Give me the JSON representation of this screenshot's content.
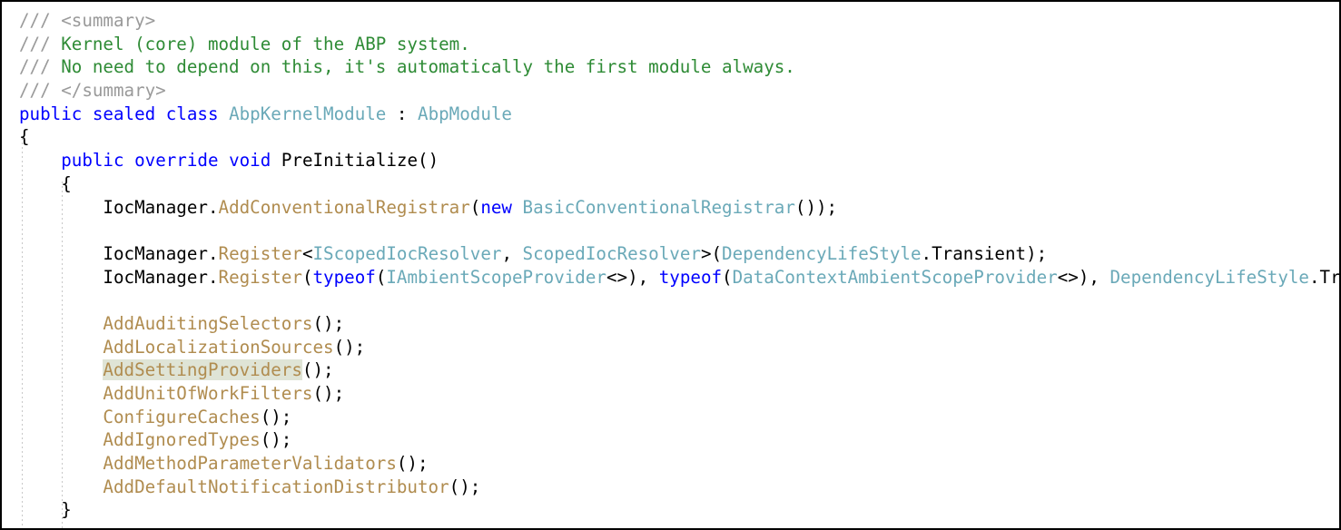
{
  "editor": {
    "language": "csharp",
    "theme": "light",
    "colors": {
      "background": "#ffffff",
      "plain": "#000000",
      "keyword": "#0000ff",
      "type": "#6aa9b8",
      "method": "#b08c4f",
      "comment": "#2e8b35",
      "comment_marker": "#9a9a9a",
      "xml_doc_tag": "#9a9a9a",
      "reference_highlight": "#dfe4d6",
      "indent_guide": "#c8c8c8",
      "frame_border": "#000000"
    },
    "highlighted_symbol": "AddSettingProviders",
    "truncated_right_edge": true
  },
  "code": {
    "lines": [
      {
        "n": 1,
        "indent": 0,
        "tokens": [
          {
            "text": "/// ",
            "kind": "commentmark"
          },
          {
            "text": "<summary>",
            "kind": "xmltag"
          }
        ]
      },
      {
        "n": 2,
        "indent": 0,
        "tokens": [
          {
            "text": "/// ",
            "kind": "commentmark"
          },
          {
            "text": "Kernel (core) module of the ABP system.",
            "kind": "comment"
          }
        ]
      },
      {
        "n": 3,
        "indent": 0,
        "tokens": [
          {
            "text": "/// ",
            "kind": "commentmark"
          },
          {
            "text": "No need to depend on this, it's automatically the first module always.",
            "kind": "comment"
          }
        ]
      },
      {
        "n": 4,
        "indent": 0,
        "tokens": [
          {
            "text": "/// ",
            "kind": "commentmark"
          },
          {
            "text": "</summary>",
            "kind": "xmltag"
          }
        ]
      },
      {
        "n": 5,
        "indent": 0,
        "tokens": [
          {
            "text": "public",
            "kind": "keyword"
          },
          {
            "text": " ",
            "kind": "plain"
          },
          {
            "text": "sealed",
            "kind": "keyword"
          },
          {
            "text": " ",
            "kind": "plain"
          },
          {
            "text": "class",
            "kind": "keyword"
          },
          {
            "text": " ",
            "kind": "plain"
          },
          {
            "text": "AbpKernelModule",
            "kind": "type"
          },
          {
            "text": " : ",
            "kind": "plain"
          },
          {
            "text": "AbpModule",
            "kind": "type"
          }
        ]
      },
      {
        "n": 6,
        "indent": 0,
        "tokens": [
          {
            "text": "{",
            "kind": "punct"
          }
        ]
      },
      {
        "n": 7,
        "indent": 1,
        "tokens": [
          {
            "text": "    ",
            "kind": "plain"
          },
          {
            "text": "public",
            "kind": "keyword"
          },
          {
            "text": " ",
            "kind": "plain"
          },
          {
            "text": "override",
            "kind": "keyword"
          },
          {
            "text": " ",
            "kind": "plain"
          },
          {
            "text": "void",
            "kind": "keyword"
          },
          {
            "text": " ",
            "kind": "plain"
          },
          {
            "text": "PreInitialize",
            "kind": "plain"
          },
          {
            "text": "()",
            "kind": "punct"
          }
        ]
      },
      {
        "n": 8,
        "indent": 1,
        "tokens": [
          {
            "text": "    {",
            "kind": "punct"
          }
        ]
      },
      {
        "n": 9,
        "indent": 2,
        "tokens": [
          {
            "text": "        ",
            "kind": "plain"
          },
          {
            "text": "IocManager",
            "kind": "plain"
          },
          {
            "text": ".",
            "kind": "punct"
          },
          {
            "text": "AddConventionalRegistrar",
            "kind": "method"
          },
          {
            "text": "(",
            "kind": "punct"
          },
          {
            "text": "new",
            "kind": "keyword"
          },
          {
            "text": " ",
            "kind": "plain"
          },
          {
            "text": "BasicConventionalRegistrar",
            "kind": "type"
          },
          {
            "text": "());",
            "kind": "punct"
          }
        ]
      },
      {
        "n": 10,
        "indent": 2,
        "tokens": []
      },
      {
        "n": 11,
        "indent": 2,
        "tokens": [
          {
            "text": "        ",
            "kind": "plain"
          },
          {
            "text": "IocManager",
            "kind": "plain"
          },
          {
            "text": ".",
            "kind": "punct"
          },
          {
            "text": "Register",
            "kind": "method"
          },
          {
            "text": "<",
            "kind": "punct"
          },
          {
            "text": "IScopedIocResolver",
            "kind": "type"
          },
          {
            "text": ", ",
            "kind": "punct"
          },
          {
            "text": "ScopedIocResolver",
            "kind": "type"
          },
          {
            "text": ">(",
            "kind": "punct"
          },
          {
            "text": "DependencyLifeStyle",
            "kind": "type"
          },
          {
            "text": ".",
            "kind": "punct"
          },
          {
            "text": "Transient",
            "kind": "plain"
          },
          {
            "text": ");",
            "kind": "punct"
          }
        ]
      },
      {
        "n": 12,
        "indent": 2,
        "truncated": true,
        "tokens": [
          {
            "text": "        ",
            "kind": "plain"
          },
          {
            "text": "IocManager",
            "kind": "plain"
          },
          {
            "text": ".",
            "kind": "punct"
          },
          {
            "text": "Register",
            "kind": "method"
          },
          {
            "text": "(",
            "kind": "punct"
          },
          {
            "text": "typeof",
            "kind": "keyword"
          },
          {
            "text": "(",
            "kind": "punct"
          },
          {
            "text": "IAmbientScopeProvider",
            "kind": "type"
          },
          {
            "text": "<>), ",
            "kind": "punct"
          },
          {
            "text": "typeof",
            "kind": "keyword"
          },
          {
            "text": "(",
            "kind": "punct"
          },
          {
            "text": "DataContextAmbientScopeProvider",
            "kind": "type"
          },
          {
            "text": "<>), ",
            "kind": "punct"
          },
          {
            "text": "DependencyLifeStyle",
            "kind": "type"
          },
          {
            "text": ".",
            "kind": "punct"
          },
          {
            "text": "Trans",
            "kind": "plain"
          }
        ]
      },
      {
        "n": 13,
        "indent": 2,
        "tokens": []
      },
      {
        "n": 14,
        "indent": 2,
        "tokens": [
          {
            "text": "        ",
            "kind": "plain"
          },
          {
            "text": "AddAuditingSelectors",
            "kind": "method"
          },
          {
            "text": "();",
            "kind": "punct"
          }
        ]
      },
      {
        "n": 15,
        "indent": 2,
        "tokens": [
          {
            "text": "        ",
            "kind": "plain"
          },
          {
            "text": "AddLocalizationSources",
            "kind": "method"
          },
          {
            "text": "();",
            "kind": "punct"
          }
        ]
      },
      {
        "n": 16,
        "indent": 2,
        "tokens": [
          {
            "text": "        ",
            "kind": "plain"
          },
          {
            "text": "AddSettingProviders",
            "kind": "method",
            "highlight": true
          },
          {
            "text": "();",
            "kind": "punct"
          }
        ]
      },
      {
        "n": 17,
        "indent": 2,
        "tokens": [
          {
            "text": "        ",
            "kind": "plain"
          },
          {
            "text": "AddUnitOfWorkFilters",
            "kind": "method"
          },
          {
            "text": "();",
            "kind": "punct"
          }
        ]
      },
      {
        "n": 18,
        "indent": 2,
        "tokens": [
          {
            "text": "        ",
            "kind": "plain"
          },
          {
            "text": "ConfigureCaches",
            "kind": "method"
          },
          {
            "text": "();",
            "kind": "punct"
          }
        ]
      },
      {
        "n": 19,
        "indent": 2,
        "tokens": [
          {
            "text": "        ",
            "kind": "plain"
          },
          {
            "text": "AddIgnoredTypes",
            "kind": "method"
          },
          {
            "text": "();",
            "kind": "punct"
          }
        ]
      },
      {
        "n": 20,
        "indent": 2,
        "tokens": [
          {
            "text": "        ",
            "kind": "plain"
          },
          {
            "text": "AddMethodParameterValidators",
            "kind": "method"
          },
          {
            "text": "();",
            "kind": "punct"
          }
        ]
      },
      {
        "n": 21,
        "indent": 2,
        "tokens": [
          {
            "text": "        ",
            "kind": "plain"
          },
          {
            "text": "AddDefaultNotificationDistributor",
            "kind": "method"
          },
          {
            "text": "();",
            "kind": "punct"
          }
        ]
      },
      {
        "n": 22,
        "indent": 1,
        "tokens": [
          {
            "text": "    }",
            "kind": "punct"
          }
        ]
      }
    ]
  }
}
